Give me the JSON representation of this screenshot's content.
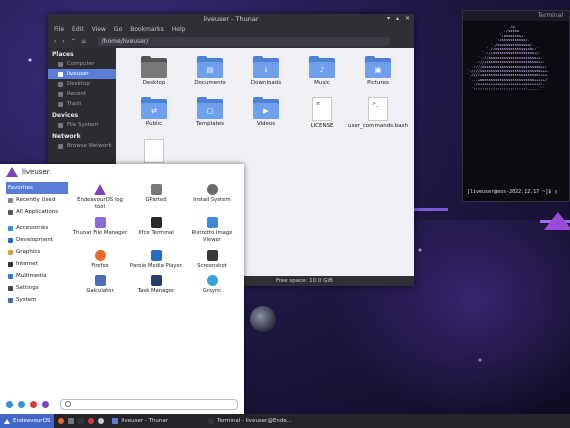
{
  "thunar": {
    "title": "liveuser - Thunar",
    "menu": [
      "File",
      "Edit",
      "View",
      "Go",
      "Bookmarks",
      "Help"
    ],
    "path": "/home/liveuser/",
    "sidebar": {
      "places_header": "Places",
      "places": [
        "Computer",
        "liveuser",
        "Desktop",
        "Recent",
        "Trash"
      ],
      "selected": "liveuser",
      "devices_header": "Devices",
      "devices": [
        "File System"
      ],
      "network_header": "Network",
      "network": [
        "Browse Network"
      ]
    },
    "files": [
      {
        "name": "Desktop",
        "kind": "folder-dark"
      },
      {
        "name": "Documents",
        "kind": "folder"
      },
      {
        "name": "Downloads",
        "kind": "folder"
      },
      {
        "name": "Music",
        "kind": "folder"
      },
      {
        "name": "Pictures",
        "kind": "folder"
      },
      {
        "name": "Public",
        "kind": "folder"
      },
      {
        "name": "Templates",
        "kind": "folder"
      },
      {
        "name": "Videos",
        "kind": "folder"
      },
      {
        "name": "LICENSE",
        "kind": "file"
      },
      {
        "name": "user_commands.bash",
        "kind": "script"
      }
    ],
    "status_text": "Free space: 10.0 GiB"
  },
  "terminal": {
    "title": "Terminal",
    "prompt": "[liveuser@eos-2022.12.17 ~]$ "
  },
  "menu": {
    "username": "liveuser",
    "categories": [
      {
        "label": "Favorites",
        "selected": true
      },
      {
        "label": "Recently Used"
      },
      {
        "label": "All Applications"
      },
      {
        "label": "Accessories"
      },
      {
        "label": "Development"
      },
      {
        "label": "Graphics"
      },
      {
        "label": "Internet"
      },
      {
        "label": "Multimedia"
      },
      {
        "label": "Settings"
      },
      {
        "label": "System"
      }
    ],
    "apps": [
      {
        "label": "EndeavourOS log tool",
        "icon": "endeavour-icon",
        "color": "#7b45c2"
      },
      {
        "label": "GParted",
        "icon": "gparted-icon",
        "color": "#777777"
      },
      {
        "label": "Install System",
        "icon": "install-icon",
        "color": "#6a6a6a"
      },
      {
        "label": "Thunar File Manager",
        "icon": "folder-icon",
        "color": "#8e6ad8"
      },
      {
        "label": "Xfce Terminal",
        "icon": "terminal-icon",
        "color": "#2b2b2b"
      },
      {
        "label": "Ristretto Image Viewer",
        "icon": "image-viewer-icon",
        "color": "#3c8ad8"
      },
      {
        "label": "Firefox",
        "icon": "firefox-icon",
        "color": "#e8692a"
      },
      {
        "label": "Parole Media Player",
        "icon": "media-player-icon",
        "color": "#2a6acb"
      },
      {
        "label": "Screenshot",
        "icon": "screenshot-icon",
        "color": "#3a3a3a"
      },
      {
        "label": "Galculator",
        "icon": "calculator-icon",
        "color": "#4a6fb6"
      },
      {
        "label": "Task Manager",
        "icon": "task-manager-icon",
        "color": "#243f6e"
      },
      {
        "label": "Grsync",
        "icon": "grsync-icon",
        "color": "#3ba0d6"
      }
    ],
    "search_placeholder": ""
  },
  "panel": {
    "start_label": "EndeavourOS",
    "tasks": [
      "liveuser - Thunar",
      "Terminal - liveuser@Ende..."
    ]
  }
}
